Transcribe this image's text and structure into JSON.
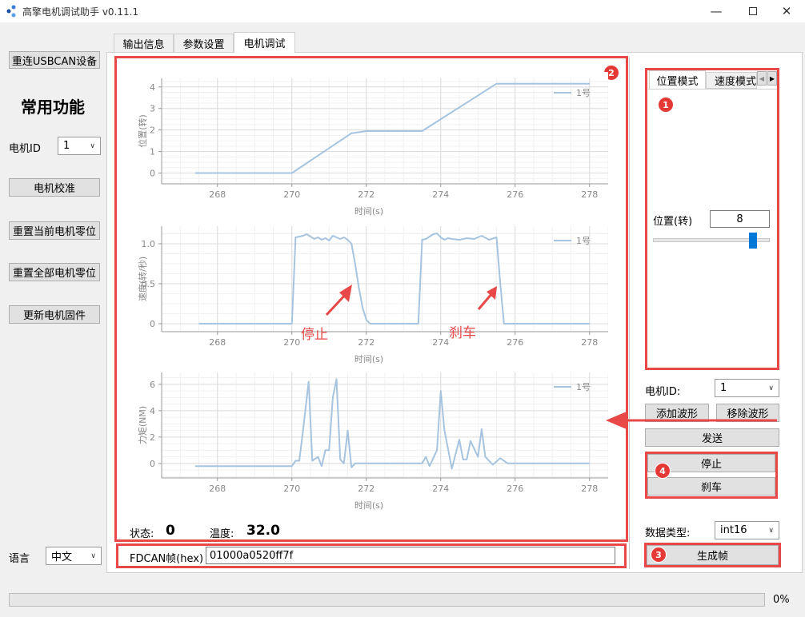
{
  "window": {
    "title": "高擎电机调试助手 v0.11.1",
    "minimize_icon": "minimize-icon",
    "maximize_icon": "maximize-icon",
    "close_icon": "close-icon"
  },
  "sidebar": {
    "reconnect_label": "重连USBCAN设备",
    "heading": "常用功能",
    "motor_id_label": "电机ID",
    "motor_id_value": "1",
    "calibrate_label": "电机校准",
    "reset_current_zero_label": "重置当前电机零位",
    "reset_all_zero_label": "重置全部电机零位",
    "update_firmware_label": "更新电机固件",
    "language_label": "语言",
    "language_value": "中文"
  },
  "tabs": [
    {
      "label": "输出信息"
    },
    {
      "label": "参数设置"
    },
    {
      "label": "电机调试"
    }
  ],
  "badges": {
    "b1": "1",
    "b2": "2",
    "b3": "3",
    "b4": "4"
  },
  "annotations": {
    "stop": "停止",
    "brake": "刹车"
  },
  "status": {
    "state_label": "状态:",
    "state_value": "0",
    "temp_label": "温度:",
    "temp_value": "32.0"
  },
  "fdcan": {
    "label": "FDCAN帧(hex)",
    "value": "01000a0520ff7f"
  },
  "mode_panel": {
    "tabs": [
      "位置模式",
      "速度模式"
    ],
    "position_label": "位置(转)",
    "position_value": "8",
    "slider_fraction": 0.88
  },
  "controls": {
    "motor_id_label": "电机ID:",
    "motor_id_value": "1",
    "add_wave_label": "添加波形",
    "remove_wave_label": "移除波形",
    "send_label": "发送",
    "stop_label": "停止",
    "brake_label": "刹车",
    "data_type_label": "数据类型:",
    "data_type_value": "int16",
    "generate_label": "生成帧"
  },
  "progress": {
    "value_text": "0%",
    "fraction": 0
  },
  "chart_data": [
    {
      "type": "line",
      "xlabel": "时间(s)",
      "ylabel": "位置(转)",
      "xlim": [
        266.5,
        278.5
      ],
      "ylim": [
        -0.5,
        4.4
      ],
      "xticks": [
        268,
        270,
        272,
        274,
        276,
        278
      ],
      "yticks": [
        0,
        1,
        2,
        3,
        4
      ],
      "tick_labels_x": [
        "268",
        "270",
        "272",
        "274",
        "276",
        "278"
      ],
      "tick_labels_y": [
        "0",
        "1",
        "2",
        "3",
        "4"
      ],
      "legend": "top-right",
      "series": [
        {
          "name": "1号",
          "x": [
            267.4,
            270.0,
            271.6,
            272.0,
            273.5,
            275.5,
            278.0
          ],
          "y": [
            0,
            0,
            1.85,
            1.95,
            1.95,
            4.15,
            4.15
          ]
        }
      ]
    },
    {
      "type": "line",
      "xlabel": "时间(s)",
      "ylabel": "速度(转/秒)",
      "xlim": [
        266.5,
        278.5
      ],
      "ylim": [
        -0.1,
        1.22
      ],
      "xticks": [
        268,
        270,
        272,
        274,
        276,
        278
      ],
      "yticks": [
        0,
        0.5,
        1.0
      ],
      "tick_labels_x": [
        "268",
        "270",
        "272",
        "274",
        "276",
        "278"
      ],
      "tick_labels_y": [
        "0",
        "0.5",
        "1.0"
      ],
      "legend": "top-right",
      "series": [
        {
          "name": "1号",
          "x": [
            267.5,
            270.0,
            270.1,
            270.3,
            270.4,
            270.5,
            270.6,
            270.7,
            270.8,
            270.9,
            271.0,
            271.1,
            271.2,
            271.3,
            271.4,
            271.5,
            271.6,
            271.7,
            271.8,
            271.9,
            272.0,
            272.1,
            272.3,
            273.4,
            273.5,
            273.6,
            273.8,
            273.9,
            274.0,
            274.1,
            274.2,
            274.3,
            274.5,
            274.7,
            274.9,
            275.1,
            275.3,
            275.5,
            275.6,
            275.7,
            278.0
          ],
          "y": [
            0,
            0,
            1.08,
            1.1,
            1.12,
            1.09,
            1.06,
            1.08,
            1.05,
            1.07,
            1.04,
            1.1,
            1.08,
            1.06,
            1.08,
            1.05,
            1.0,
            0.75,
            0.45,
            0.2,
            0.05,
            0,
            0,
            0,
            1.05,
            1.06,
            1.12,
            1.13,
            1.08,
            1.05,
            1.07,
            1.06,
            1.05,
            1.07,
            1.06,
            1.1,
            1.05,
            1.08,
            0.5,
            0,
            0
          ]
        }
      ]
    },
    {
      "type": "line",
      "xlabel": "时间(s)",
      "ylabel": "力矩(NM)",
      "xlim": [
        266.5,
        278.5
      ],
      "ylim": [
        -1.1,
        6.9
      ],
      "xticks": [
        268,
        270,
        272,
        274,
        276,
        278
      ],
      "yticks": [
        0,
        2,
        4,
        6
      ],
      "tick_labels_x": [
        "268",
        "270",
        "272",
        "274",
        "276",
        "278"
      ],
      "tick_labels_y": [
        "0",
        "2",
        "4",
        "6"
      ],
      "legend": "top-right",
      "series": [
        {
          "name": "1号",
          "x": [
            267.4,
            270.0,
            270.1,
            270.2,
            270.3,
            270.45,
            270.55,
            270.7,
            270.8,
            270.9,
            271.0,
            271.1,
            271.2,
            271.3,
            271.4,
            271.5,
            271.6,
            271.7,
            271.8,
            273.5,
            273.6,
            273.7,
            273.9,
            274.0,
            274.1,
            274.3,
            274.5,
            274.6,
            274.7,
            274.8,
            275.0,
            275.1,
            275.2,
            275.4,
            275.6,
            275.8,
            278.0
          ],
          "y": [
            -0.2,
            -0.2,
            0.2,
            0.2,
            2.5,
            6.2,
            0.2,
            0.5,
            -0.2,
            1.0,
            1.0,
            5.0,
            6.4,
            0.3,
            0.0,
            2.5,
            -0.3,
            0.0,
            0.0,
            0.0,
            0.5,
            -0.2,
            1.0,
            5.5,
            2.5,
            -0.4,
            1.8,
            0.3,
            0.3,
            1.7,
            0.5,
            2.6,
            0.5,
            -0.1,
            0.4,
            0.0,
            0.0
          ]
        }
      ]
    }
  ]
}
